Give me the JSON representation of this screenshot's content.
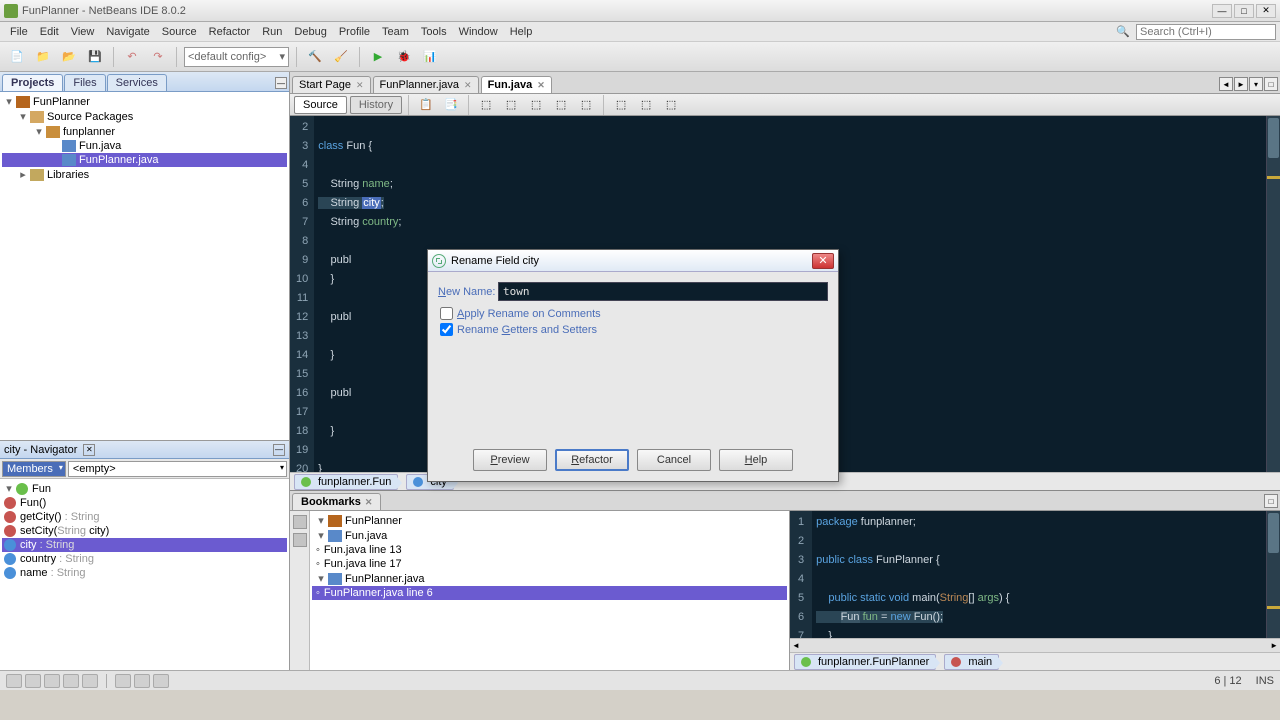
{
  "titlebar": {
    "title": "FunPlanner - NetBeans IDE 8.0.2"
  },
  "menu": [
    "File",
    "Edit",
    "View",
    "Navigate",
    "Source",
    "Refactor",
    "Run",
    "Debug",
    "Profile",
    "Team",
    "Tools",
    "Window",
    "Help"
  ],
  "search_placeholder": "Search (Ctrl+I)",
  "toolbar_combo": "<default config>",
  "panel_tabs": [
    "Projects",
    "Files",
    "Services"
  ],
  "project_tree": {
    "root": "FunPlanner",
    "src": "Source Packages",
    "pkg": "funplanner",
    "file1": "Fun.java",
    "file2": "FunPlanner.java",
    "libs": "Libraries"
  },
  "navigator": {
    "title": "city - Navigator",
    "filter1": "Members",
    "filter2": "<empty>",
    "class": "Fun",
    "ctor": "Fun()",
    "m1": "getCity()",
    "m1t": ": String",
    "m2": "setCity(",
    "m2p": "String",
    "m2a": " city)",
    "f1": "city",
    "f1t": ": String",
    "f2": "country",
    "f2t": ": String",
    "f3": "name",
    "f3t": ": String"
  },
  "editor_tabs": [
    "Start Page",
    "FunPlanner.java",
    "Fun.java"
  ],
  "src_history": {
    "source": "Source",
    "history": "History"
  },
  "code_lines": {
    "l2": "",
    "l3": "class Fun {",
    "l4": "",
    "l5_a": "    String ",
    "l5_b": "name",
    "l5_c": ";",
    "l6_a": "    String ",
    "l6_b": "city",
    "l6_c": ";",
    "l7_a": "    String ",
    "l7_b": "country",
    "l7_c": ";",
    "l8": "",
    "l9": "    publ",
    "l10": "    }",
    "l11": "",
    "l12": "    publ",
    "l13": "",
    "l14": "    }",
    "l15": "",
    "l16": "    publ",
    "l17": "",
    "l18": "    }",
    "l19": "",
    "l20": "}",
    "l21": ""
  },
  "breadcrumb1": {
    "c1": "funplanner.Fun",
    "c2": "city"
  },
  "bookmarks": {
    "title": "Bookmarks",
    "root": "FunPlanner",
    "f1": "Fun.java",
    "f1l1": "Fun.java line 13",
    "f1l2": "Fun.java line 17",
    "f2": "FunPlanner.java",
    "f2l1": "FunPlanner.java line 6"
  },
  "preview_lines": {
    "l1": "package funplanner;",
    "l2": "",
    "l3": "public class FunPlanner {",
    "l4": "",
    "l5_a": "    public static void main(",
    "l5_b": "String",
    "l5_c": "[] ",
    "l5_d": "args",
    "l5_e": ") {",
    "l6_a": "        ",
    "l6_b": "Fun",
    "l6_c": " fun = new Fun();",
    "l7": "    }"
  },
  "breadcrumb2": {
    "c1": "funplanner.FunPlanner",
    "c2": "main"
  },
  "status": {
    "pos": "6 | 12",
    "ins": "INS"
  },
  "dialog": {
    "title": "Rename Field city",
    "new_name_label": "New Name:",
    "new_name_value": "town",
    "check1": "Apply Rename on Comments",
    "check2": "Rename Getters and Setters",
    "btn_preview": "Preview",
    "btn_refactor": "Refactor",
    "btn_cancel": "Cancel",
    "btn_help": "Help"
  }
}
